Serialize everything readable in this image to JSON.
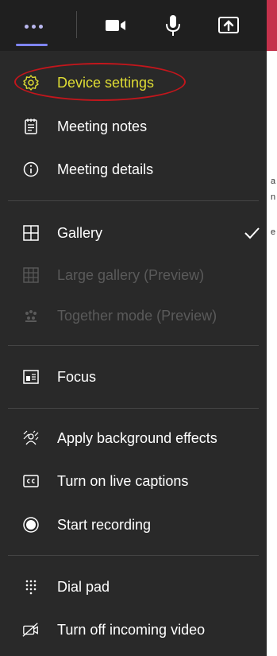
{
  "toolbar": {
    "buttons": [
      {
        "name": "more-actions",
        "icon": "ellipsis-icon"
      },
      {
        "name": "camera",
        "icon": "video-camera-icon"
      },
      {
        "name": "microphone",
        "icon": "microphone-icon"
      },
      {
        "name": "share",
        "icon": "share-screen-icon"
      }
    ]
  },
  "menu": {
    "items": [
      {
        "label": "Device settings",
        "icon": "gear-icon",
        "highlighted": true
      },
      {
        "label": "Meeting notes",
        "icon": "notes-icon"
      },
      {
        "label": "Meeting details",
        "icon": "info-icon"
      },
      {
        "label": "Gallery",
        "icon": "gallery-grid-icon",
        "checked": true
      },
      {
        "label": "Large gallery (Preview)",
        "icon": "large-gallery-icon",
        "disabled": true
      },
      {
        "label": "Together mode (Preview)",
        "icon": "together-mode-icon",
        "disabled": true
      },
      {
        "label": "Focus",
        "icon": "focus-icon"
      },
      {
        "label": "Apply background effects",
        "icon": "background-effects-icon"
      },
      {
        "label": "Turn on live captions",
        "icon": "captions-icon"
      },
      {
        "label": "Start recording",
        "icon": "record-icon"
      },
      {
        "label": "Dial pad",
        "icon": "dial-pad-icon"
      },
      {
        "label": "Turn off incoming video",
        "icon": "video-off-icon"
      }
    ]
  },
  "side_fragments": [
    "a",
    "n",
    "e"
  ],
  "colors": {
    "menu_bg": "#292929",
    "highlight_text": "#dedc34",
    "annotation_circle": "#c3161c",
    "accent": "#7f85f5"
  }
}
